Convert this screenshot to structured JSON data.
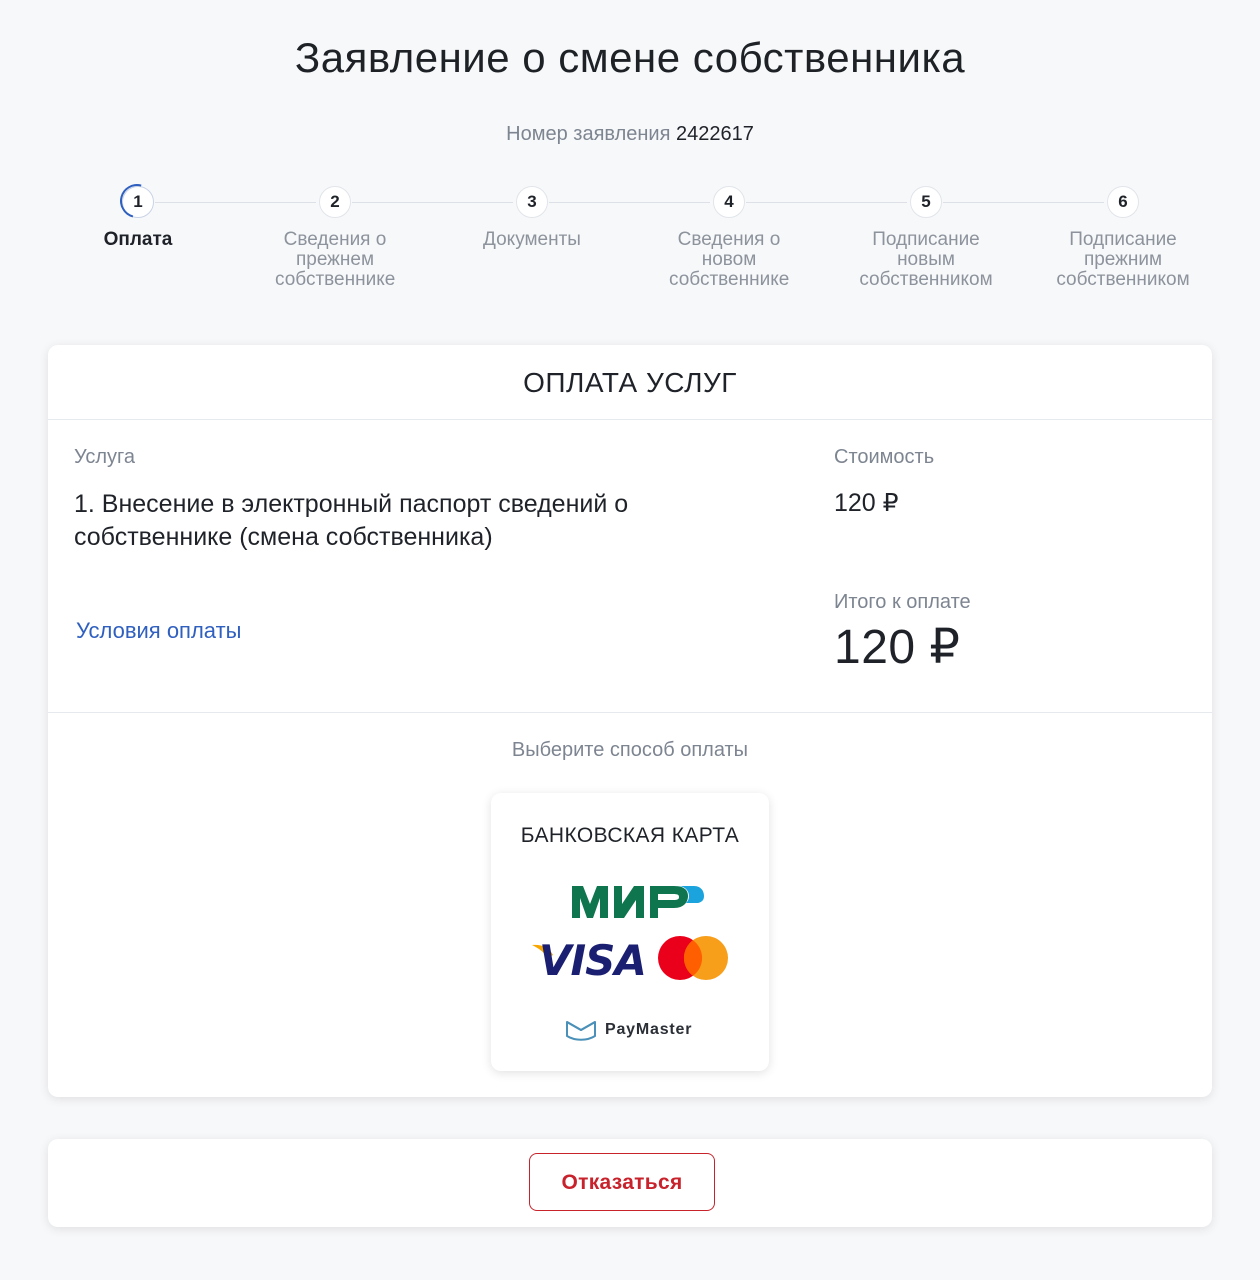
{
  "header": {
    "title": "Заявление о смене собственника",
    "app_number_label": "Номер заявления",
    "app_number_value": "2422617"
  },
  "stepper": {
    "active_step": 1,
    "steps": [
      {
        "number": "1",
        "label": "Оплата"
      },
      {
        "number": "2",
        "label": "Сведения о прежнем собственнике"
      },
      {
        "number": "3",
        "label": "Документы"
      },
      {
        "number": "4",
        "label": "Сведения о новом собственнике"
      },
      {
        "number": "5",
        "label": "Подписание новым собственником"
      },
      {
        "number": "6",
        "label": "Подписание прежним собственником"
      }
    ]
  },
  "payment": {
    "title": "ОПЛАТА УСЛУГ",
    "service_label": "Услуга",
    "cost_label": "Стоимость",
    "service_text": "1. Внесение в электронный паспорт сведений о собственнике (смена собственника)",
    "price": "120 ₽",
    "terms_link": "Условия оплаты",
    "total_label": "Итого к оплате",
    "total_value": "120 ₽",
    "choose_method_label": "Выберите способ оплаты",
    "method": {
      "title": "БАНКОВСКАЯ КАРТА",
      "logos": [
        "mir-logo",
        "visa-logo",
        "mastercard-logo",
        "paymaster-logo"
      ],
      "paymaster_text": "PayMaster"
    }
  },
  "footer": {
    "cancel_label": "Отказаться"
  },
  "colors": {
    "accent": "#2f5fbf",
    "danger": "#c8232c",
    "mir_green": "#0f754e",
    "visa_blue": "#1a1f71",
    "visa_gold": "#f7a600",
    "mc_red": "#eb001b",
    "mc_orange": "#f79e1b"
  }
}
